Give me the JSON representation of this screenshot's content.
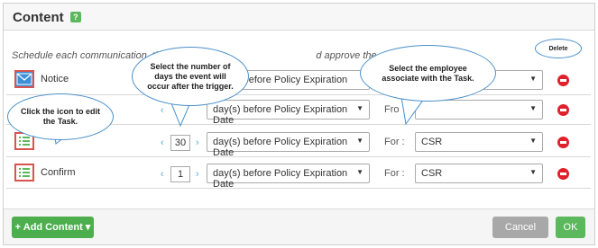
{
  "header": {
    "title": "Content",
    "help_icon": "?"
  },
  "instructions": {
    "text": "Schedule each communication, the",
    "text_after": "d approve the content.",
    "help_icon": "?"
  },
  "rows": [
    {
      "name": "Notice",
      "icon": "envelope-icon",
      "days": "",
      "relation": "day(s) before Policy Expiration Date",
      "for_label": "",
      "for_value": ""
    },
    {
      "name": "",
      "icon": "task-list-icon",
      "days": "",
      "relation": "day(s) before Policy Expiration Date",
      "for_label": "Fro",
      "for_value": ""
    },
    {
      "name": "",
      "icon": "task-list-icon",
      "days": "30",
      "relation": "day(s) before Policy Expiration Date",
      "for_label": "For :",
      "for_value": "CSR"
    },
    {
      "name": "Confirm",
      "icon": "task-list-icon",
      "days": "1",
      "relation": "day(s) before Policy Expiration Date",
      "for_label": "For :",
      "for_value": "CSR"
    }
  ],
  "callouts": {
    "days": "Select the number of days the event will occur after the trigger.",
    "employee": "Select the employee associate with the Task.",
    "icon": "Click the icon to edit the Task.",
    "delete": "Delete"
  },
  "footer": {
    "add_label": "+ Add Content",
    "add_caret": "▾",
    "cancel_label": "Cancel",
    "ok_label": "OK"
  },
  "colors": {
    "accent_green": "#5cb85c",
    "delete_red": "#e0212b",
    "callout_border": "#4a8fc9"
  }
}
